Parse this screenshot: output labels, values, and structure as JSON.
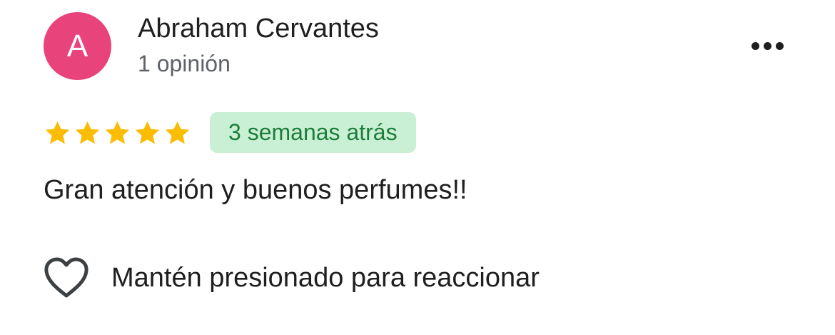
{
  "review": {
    "author": {
      "initial": "A",
      "name": "Abraham Cervantes",
      "meta": "1 opinión",
      "avatar_color": "#e8437a"
    },
    "more_icon": "more-horizontal-icon",
    "rating": {
      "value": 5,
      "max": 5,
      "star_icon": "star-icon",
      "star_color": "#fbbc04"
    },
    "date_badge": {
      "label": "3 semanas atrás",
      "bg_color": "#c9f0d4",
      "text_color": "#1e7d3a"
    },
    "text": "Gran atención y buenos perfumes!!",
    "reaction": {
      "icon": "heart-outline-icon",
      "label": "Mantén presionado para reaccionar"
    }
  }
}
